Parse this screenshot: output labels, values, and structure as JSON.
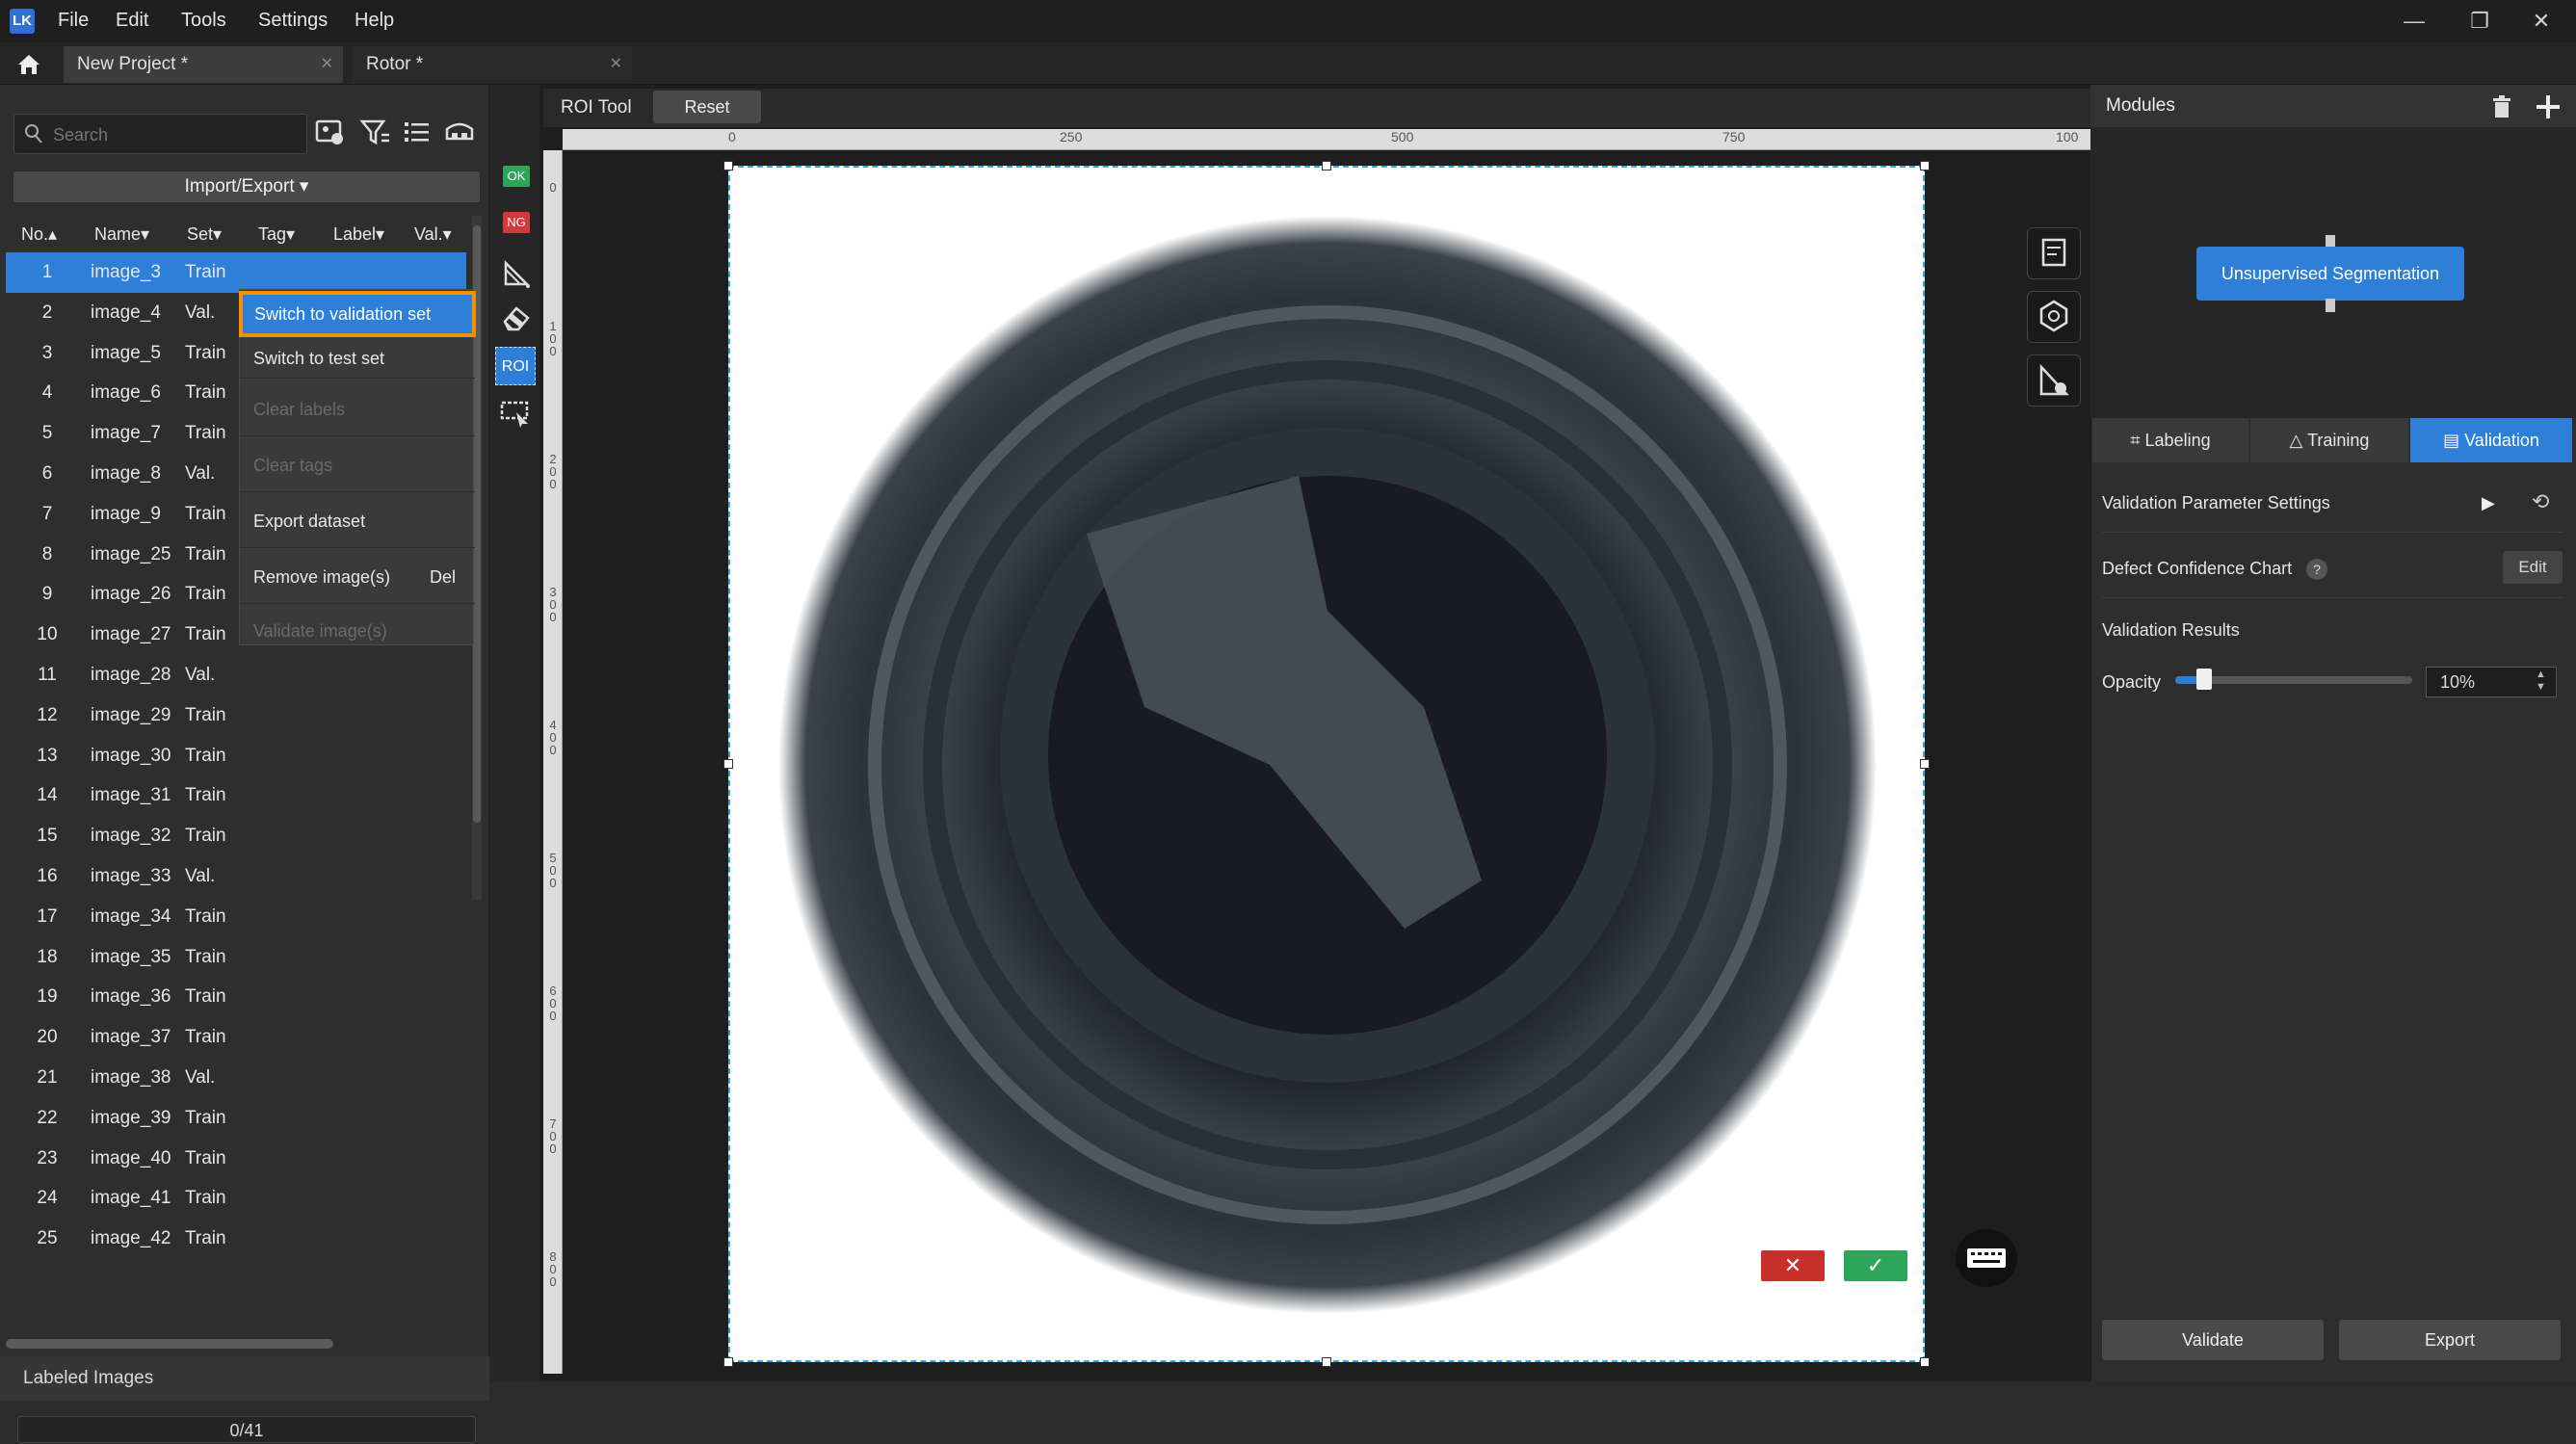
{
  "app": {
    "logo_text": "LK"
  },
  "menu": [
    "File",
    "Edit",
    "Tools",
    "Settings",
    "Help"
  ],
  "tabs": [
    {
      "label": "New Project *"
    },
    {
      "label": "Rotor *"
    }
  ],
  "left": {
    "search_placeholder": "Search",
    "import_export": "Import/Export ▾",
    "columns": [
      "No.▴",
      "Name▾",
      "Set▾",
      "Tag▾",
      "Label▾",
      "Val.▾"
    ],
    "rows": [
      {
        "no": "1",
        "name": "image_3",
        "set": "Train"
      },
      {
        "no": "2",
        "name": "image_4",
        "set": "Val."
      },
      {
        "no": "3",
        "name": "image_5",
        "set": "Train"
      },
      {
        "no": "4",
        "name": "image_6",
        "set": "Train"
      },
      {
        "no": "5",
        "name": "image_7",
        "set": "Train"
      },
      {
        "no": "6",
        "name": "image_8",
        "set": "Val."
      },
      {
        "no": "7",
        "name": "image_9",
        "set": "Train"
      },
      {
        "no": "8",
        "name": "image_25",
        "set": "Train"
      },
      {
        "no": "9",
        "name": "image_26",
        "set": "Train"
      },
      {
        "no": "10",
        "name": "image_27",
        "set": "Train"
      },
      {
        "no": "11",
        "name": "image_28",
        "set": "Val."
      },
      {
        "no": "12",
        "name": "image_29",
        "set": "Train"
      },
      {
        "no": "13",
        "name": "image_30",
        "set": "Train"
      },
      {
        "no": "14",
        "name": "image_31",
        "set": "Train"
      },
      {
        "no": "15",
        "name": "image_32",
        "set": "Train"
      },
      {
        "no": "16",
        "name": "image_33",
        "set": "Val."
      },
      {
        "no": "17",
        "name": "image_34",
        "set": "Train"
      },
      {
        "no": "18",
        "name": "image_35",
        "set": "Train"
      },
      {
        "no": "19",
        "name": "image_36",
        "set": "Train"
      },
      {
        "no": "20",
        "name": "image_37",
        "set": "Train"
      },
      {
        "no": "21",
        "name": "image_38",
        "set": "Val."
      },
      {
        "no": "22",
        "name": "image_39",
        "set": "Train"
      },
      {
        "no": "23",
        "name": "image_40",
        "set": "Train"
      },
      {
        "no": "24",
        "name": "image_41",
        "set": "Train"
      },
      {
        "no": "25",
        "name": "image_42",
        "set": "Train"
      }
    ],
    "labeled_images": "Labeled Images",
    "progress": "0/41"
  },
  "context_menu": {
    "items": [
      {
        "label": "Switch to validation set",
        "disabled": false
      },
      {
        "label": "Switch to test set",
        "disabled": false
      },
      {
        "label": "Clear labels",
        "disabled": true
      },
      {
        "label": "Clear tags",
        "disabled": true
      },
      {
        "label": "Export dataset",
        "disabled": false
      },
      {
        "label": "Remove image(s)",
        "key": "Del",
        "disabled": false
      },
      {
        "label": "Validate image(s)",
        "disabled": true
      }
    ]
  },
  "toolstrip": {
    "ok": "OK",
    "ng": "NG",
    "roi": "ROI"
  },
  "canvas": {
    "roi_tool": "ROI Tool",
    "reset": "Reset",
    "ruler_top": [
      "0",
      "250",
      "500",
      "750",
      "100"
    ],
    "ruler_left": [
      "0",
      "1\n0\n0",
      "2\n0\n0",
      "3\n0\n0",
      "4\n0\n0",
      "5\n0\n0",
      "6\n0\n0",
      "7\n0\n0",
      "8\n0\n0"
    ]
  },
  "right": {
    "modules": "Modules",
    "module_name": "Unsupervised Segmentation",
    "tabs": [
      "Labeling",
      "Training",
      "Validation"
    ],
    "validation_param": "Validation Parameter Settings",
    "defect_chart": "Defect Confidence Chart",
    "edit": "Edit",
    "validation_results": "Validation Results",
    "opacity_label": "Opacity",
    "opacity_value": "10%",
    "opacity_level": 0.1,
    "validate": "Validate",
    "export": "Export"
  },
  "colors": {
    "accent": "#2d7fd8",
    "highlight": "#f39200",
    "ok": "#2ea65a",
    "ng": "#d03a3a"
  }
}
